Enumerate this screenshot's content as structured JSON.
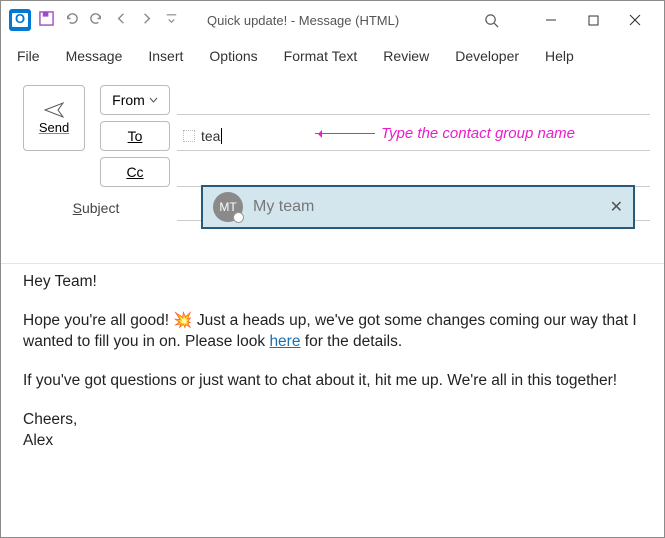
{
  "titlebar": {
    "title": "Quick update!  -  Message (HTML)"
  },
  "menu": [
    "File",
    "Message",
    "Insert",
    "Options",
    "Format Text",
    "Review",
    "Developer",
    "Help"
  ],
  "compose": {
    "send": "Send",
    "from": "From",
    "to": "To",
    "cc": "Cc",
    "subject_label": "Subject",
    "to_value": "tea"
  },
  "annotation": "Type the contact group name",
  "suggestion": {
    "initials": "MT",
    "name": "My team"
  },
  "body": {
    "greeting": "Hey Team!",
    "p1a": "Hope you're all good! 💥 Just a heads up, we've got some changes coming our way that I wanted to fill you in on. Please look ",
    "link": "here",
    "p1b": " for the details.",
    "p2": "If you've got questions or just want to chat about it, hit me up. We're all in this together!",
    "sig1": "Cheers,",
    "sig2": "Alex"
  }
}
